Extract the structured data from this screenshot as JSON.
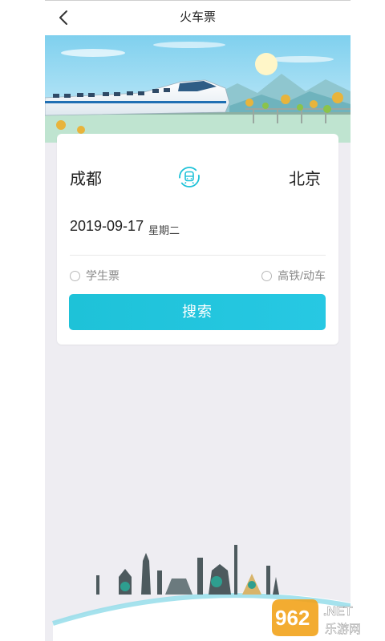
{
  "header": {
    "title": "火车票"
  },
  "search": {
    "from_city": "成都",
    "to_city": "北京",
    "date": "2019-09-17",
    "weekday": "星期二",
    "option_student": "学生票",
    "option_highspeed": "高铁/动车",
    "button_label": "搜索"
  },
  "watermark": {
    "brand_number": "962",
    "brand_suffix": ".NET",
    "brand_cn": "乐游网"
  },
  "colors": {
    "accent": "#1ec2d8",
    "background": "#eeedf2",
    "card": "#ffffff"
  }
}
